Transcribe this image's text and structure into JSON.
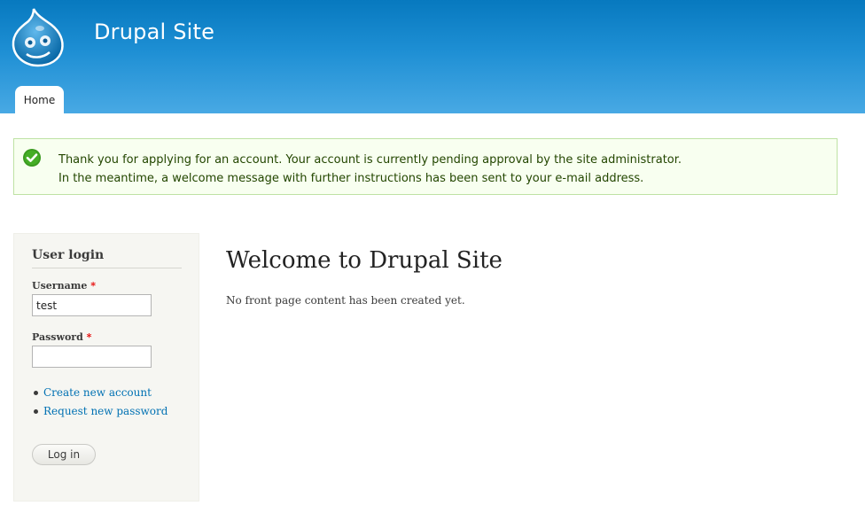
{
  "header": {
    "site_name": "Drupal Site",
    "logo_icon": "drupal-drop-icon",
    "nav": [
      {
        "label": "Home",
        "active": true
      }
    ]
  },
  "status_message": {
    "icon": "check-circle-icon",
    "lines": [
      "Thank you for applying for an account. Your account is currently pending approval by the site administrator.",
      "In the meantime, a welcome message with further instructions has been sent to your e-mail address."
    ]
  },
  "login_block": {
    "title": "User login",
    "username": {
      "label": "Username",
      "required_marker": "*",
      "value": "test"
    },
    "password": {
      "label": "Password",
      "required_marker": "*",
      "value": ""
    },
    "links": [
      "Create new account",
      "Request new password"
    ],
    "submit_label": "Log in"
  },
  "main": {
    "title": "Welcome to Drupal Site",
    "body": "No front page content has been created yet."
  },
  "colors": {
    "header_top": "#0779bf",
    "header_bottom": "#48a9e4",
    "status_bg": "#f8fff0",
    "status_border": "#bee2a4",
    "status_text": "#234600",
    "link": "#0071b3",
    "required": "#e60000"
  }
}
